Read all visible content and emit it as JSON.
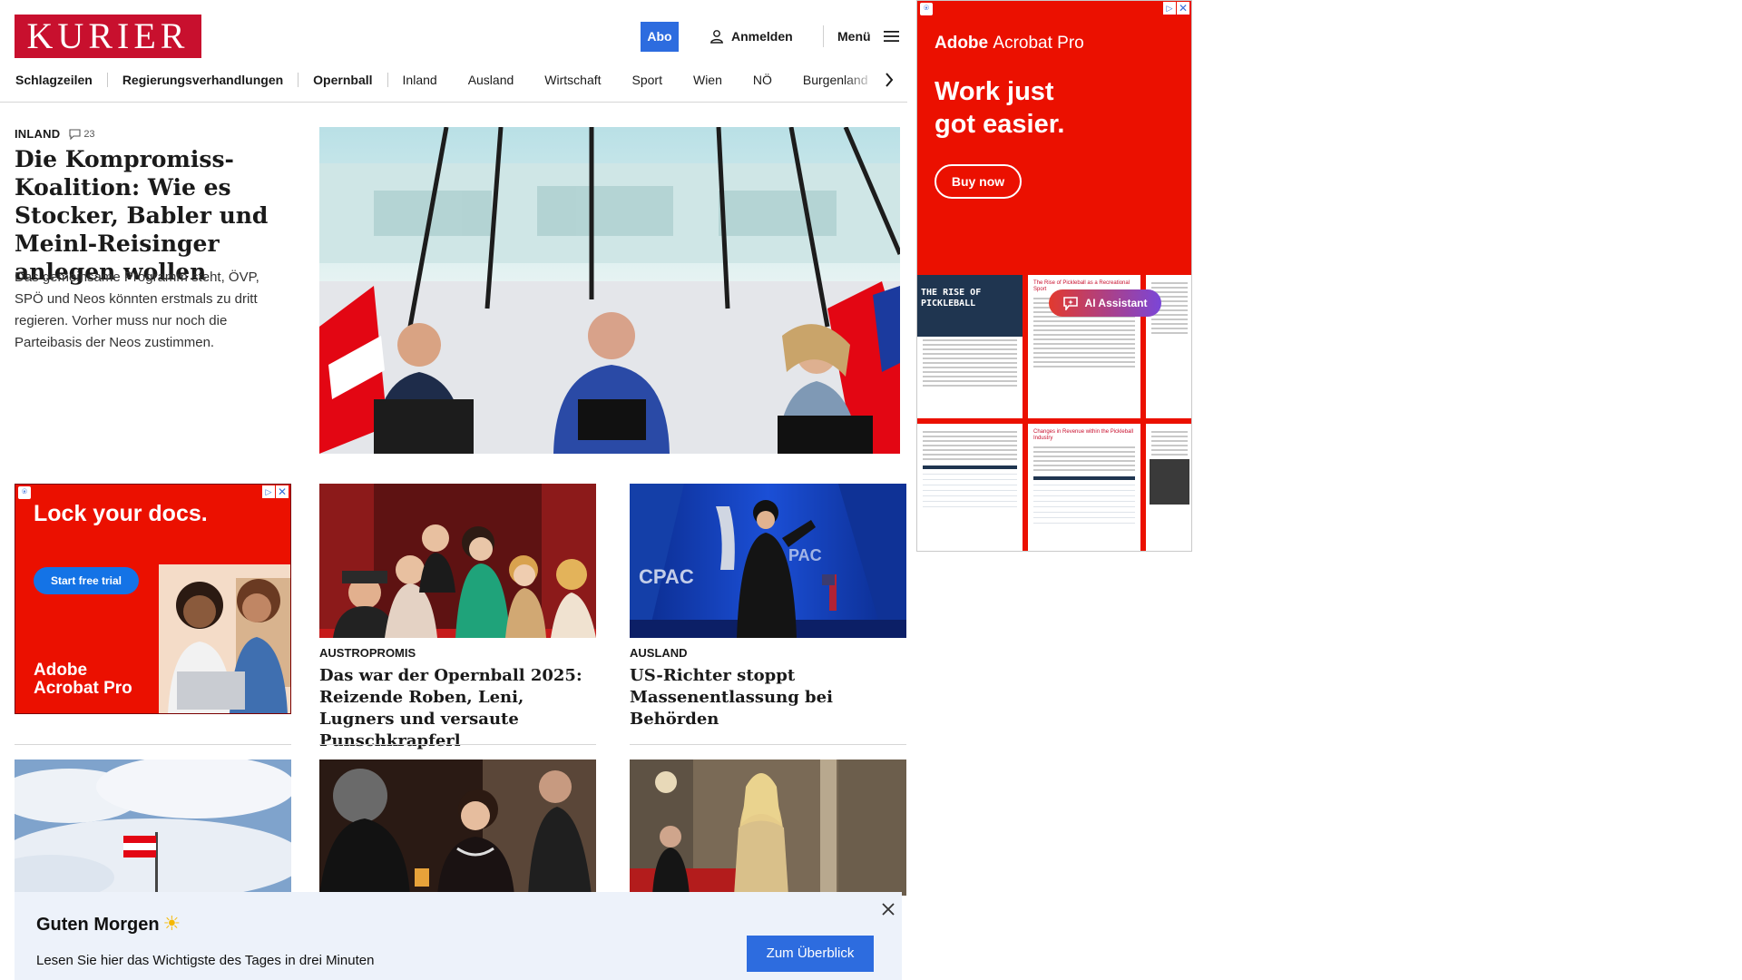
{
  "header": {
    "logo": "KURIER",
    "abo_label": "Abo",
    "login_label": "Anmelden",
    "menu_label": "Menü"
  },
  "nav": {
    "items": [
      "Schlagzeilen",
      "Regierungsverhandlungen",
      "Opernball",
      "Inland",
      "Ausland",
      "Wirtschaft",
      "Sport",
      "Wien",
      "NÖ",
      "Burgenland"
    ]
  },
  "lead": {
    "kicker": "INLAND",
    "comment_count": "23",
    "title": "Die Kompromiss-Koalition: Wie es Stocker, Babler und Meinl-Reisinger anlegen wollen",
    "teaser": "Das gemeinsame Programm steht, ÖVP, SPÖ und Neos könnten erstmals zu dritt regieren. Vorher muss nur noch die Parteibasis der Neos zustimmen."
  },
  "ad_left": {
    "headline": "Lock your docs.",
    "button": "Start free trial",
    "brand_line1": "Adobe",
    "brand_line2": "Acrobat Pro"
  },
  "ad_right": {
    "brand_a": "Adobe",
    "brand_b": "Acrobat Pro",
    "headline_line1": "Work just",
    "headline_line2": "got easier.",
    "button": "Buy now",
    "assistant": "AI Assistant",
    "doc1_title": "THE RISE OF PICKLEBALL",
    "doc2_title": "The Rise of Pickleball as a Recreational Sport",
    "doc3_title": "Changes in Revenue within the Pickleball Industry"
  },
  "cards": [
    {
      "kicker": "AUSTROPROMIS",
      "title": "Das war der Opernball 2025: Reizende Roben, Leni, Lugners und versaute Punschkrapferl"
    },
    {
      "kicker": "AUSLAND",
      "title": "US-Richter stoppt Massenentlassung bei Behörden"
    }
  ],
  "banner": {
    "title": "Guten Morgen",
    "sun": "☀",
    "text": "Lesen Sie hier das Wichtigste des Tages in drei Minuten",
    "button": "Zum Überblick"
  },
  "colors": {
    "brand_red": "#c8102e",
    "accent_blue": "#2d6cdf",
    "adobe_red": "#eb1000",
    "banner_bg": "#edf2fa"
  }
}
